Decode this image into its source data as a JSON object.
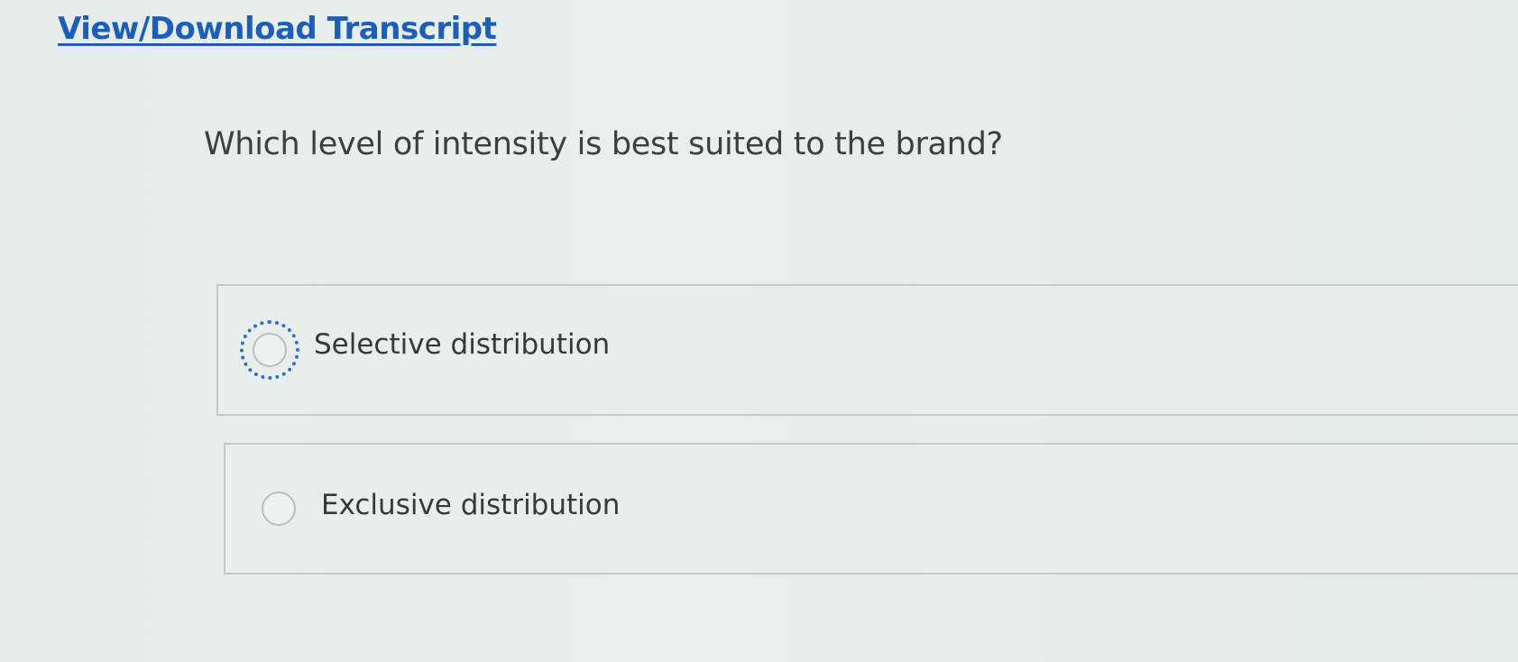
{
  "header": {
    "transcript_link": "View/Download Transcript"
  },
  "question": {
    "text": "Which level of intensity is best suited to the brand?"
  },
  "options": [
    {
      "label": "Selective distribution",
      "selected": false,
      "focused": true
    },
    {
      "label": "Exclusive distribution",
      "selected": false,
      "focused": false
    }
  ],
  "colors": {
    "link": "#1d5fb8",
    "focus_ring": "#2d6fd0",
    "background": "#e8eeeb",
    "text": "#333a37",
    "border": "#c3cbc7"
  }
}
